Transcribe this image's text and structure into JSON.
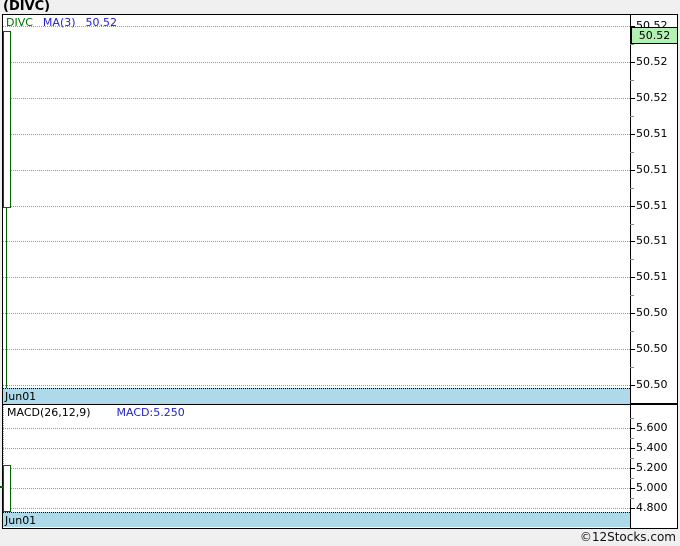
{
  "page": {
    "title": "(DIVC)",
    "watermark": "©12Stocks.com"
  },
  "main_chart": {
    "legend": {
      "symbol": "DIVC",
      "ma": "MA(3)",
      "value": "50.52"
    },
    "current_price": "50.52",
    "date": "Jun01",
    "y_labels": [
      "50.52",
      "50.52",
      "50.52",
      "50.51",
      "50.51",
      "50.51",
      "50.51",
      "50.51",
      "50.50",
      "50.50",
      "50.50"
    ]
  },
  "macd_chart": {
    "legend": {
      "name": "MACD(26,12,9)",
      "value": "MACD:5.250"
    },
    "date": "Jun01",
    "y_labels": [
      "5.600",
      "5.400",
      "5.200",
      "5.000",
      "4.800"
    ]
  },
  "colors": {
    "candle_up_outline": "#006400",
    "current_price_bg": "#b2f1b2",
    "date_bar_bg": "#aed9e8",
    "legend_symbol": "#007000",
    "legend_value_blue": "#2222cc",
    "gridline": "#999999"
  },
  "chart_data": [
    {
      "type": "candlestick",
      "title": "(DIVC)",
      "x": [
        "Jun01"
      ],
      "series": [
        {
          "name": "DIVC",
          "ohlc": [
            {
              "open": 50.51,
              "high": 50.52,
              "low": 50.5,
              "close": 50.52
            }
          ]
        }
      ],
      "overlays": [
        {
          "name": "MA(3)",
          "last_value": 50.52
        }
      ],
      "current_price": 50.52,
      "ylabel": "",
      "xlabel": "",
      "y_ticks": [
        50.52,
        50.52,
        50.52,
        50.51,
        50.51,
        50.51,
        50.51,
        50.51,
        50.5,
        50.5,
        50.5
      ],
      "ylim": [
        50.4975,
        50.5235
      ],
      "grid": true,
      "legend_position": "top-left"
    },
    {
      "type": "bar",
      "title": "MACD(26,12,9)",
      "x": [
        "Jun01"
      ],
      "values": [
        5.25
      ],
      "bar_range": [
        4.78,
        5.23
      ],
      "y_ticks": [
        5.6,
        5.4,
        5.2,
        5.0,
        4.8
      ],
      "ylim": [
        4.72,
        5.7
      ],
      "grid": true,
      "legend_position": "top-left"
    }
  ]
}
